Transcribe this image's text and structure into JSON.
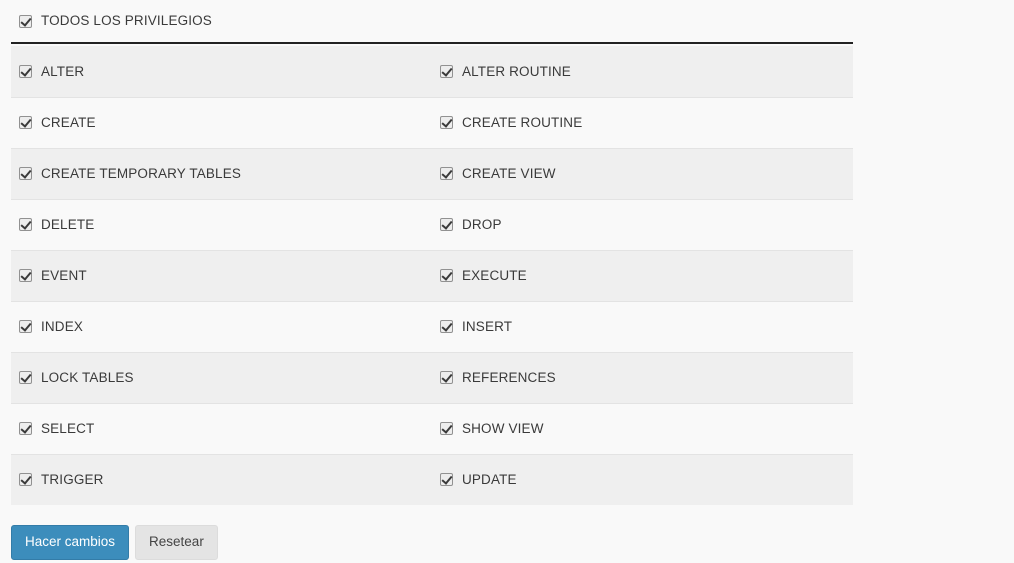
{
  "global_privilege": {
    "label": "TODOS LOS PRIVILEGIOS",
    "checked": true
  },
  "privileges": {
    "rows": [
      {
        "left": {
          "label": "ALTER",
          "checked": true
        },
        "right": {
          "label": "ALTER ROUTINE",
          "checked": true
        }
      },
      {
        "left": {
          "label": "CREATE",
          "checked": true
        },
        "right": {
          "label": "CREATE ROUTINE",
          "checked": true
        }
      },
      {
        "left": {
          "label": "CREATE TEMPORARY TABLES",
          "checked": true
        },
        "right": {
          "label": "CREATE VIEW",
          "checked": true
        }
      },
      {
        "left": {
          "label": "DELETE",
          "checked": true
        },
        "right": {
          "label": "DROP",
          "checked": true
        }
      },
      {
        "left": {
          "label": "EVENT",
          "checked": true
        },
        "right": {
          "label": "EXECUTE",
          "checked": true
        }
      },
      {
        "left": {
          "label": "INDEX",
          "checked": true
        },
        "right": {
          "label": "INSERT",
          "checked": true
        }
      },
      {
        "left": {
          "label": "LOCK TABLES",
          "checked": true
        },
        "right": {
          "label": "REFERENCES",
          "checked": true
        }
      },
      {
        "left": {
          "label": "SELECT",
          "checked": true
        },
        "right": {
          "label": "SHOW VIEW",
          "checked": true
        }
      },
      {
        "left": {
          "label": "TRIGGER",
          "checked": true
        },
        "right": {
          "label": "UPDATE",
          "checked": true
        }
      }
    ]
  },
  "actions": {
    "submit_label": "Hacer cambios",
    "reset_label": "Resetear"
  },
  "colors": {
    "page_background": "#f9f9f9",
    "row_odd": "#efefef",
    "row_even": "#f9f9f9",
    "row_divider": "#e3e3e3",
    "header_divider": "#222222",
    "text": "#3a3a3a",
    "primary_button": "#3c8dbc",
    "default_button": "#e4e4e4"
  }
}
